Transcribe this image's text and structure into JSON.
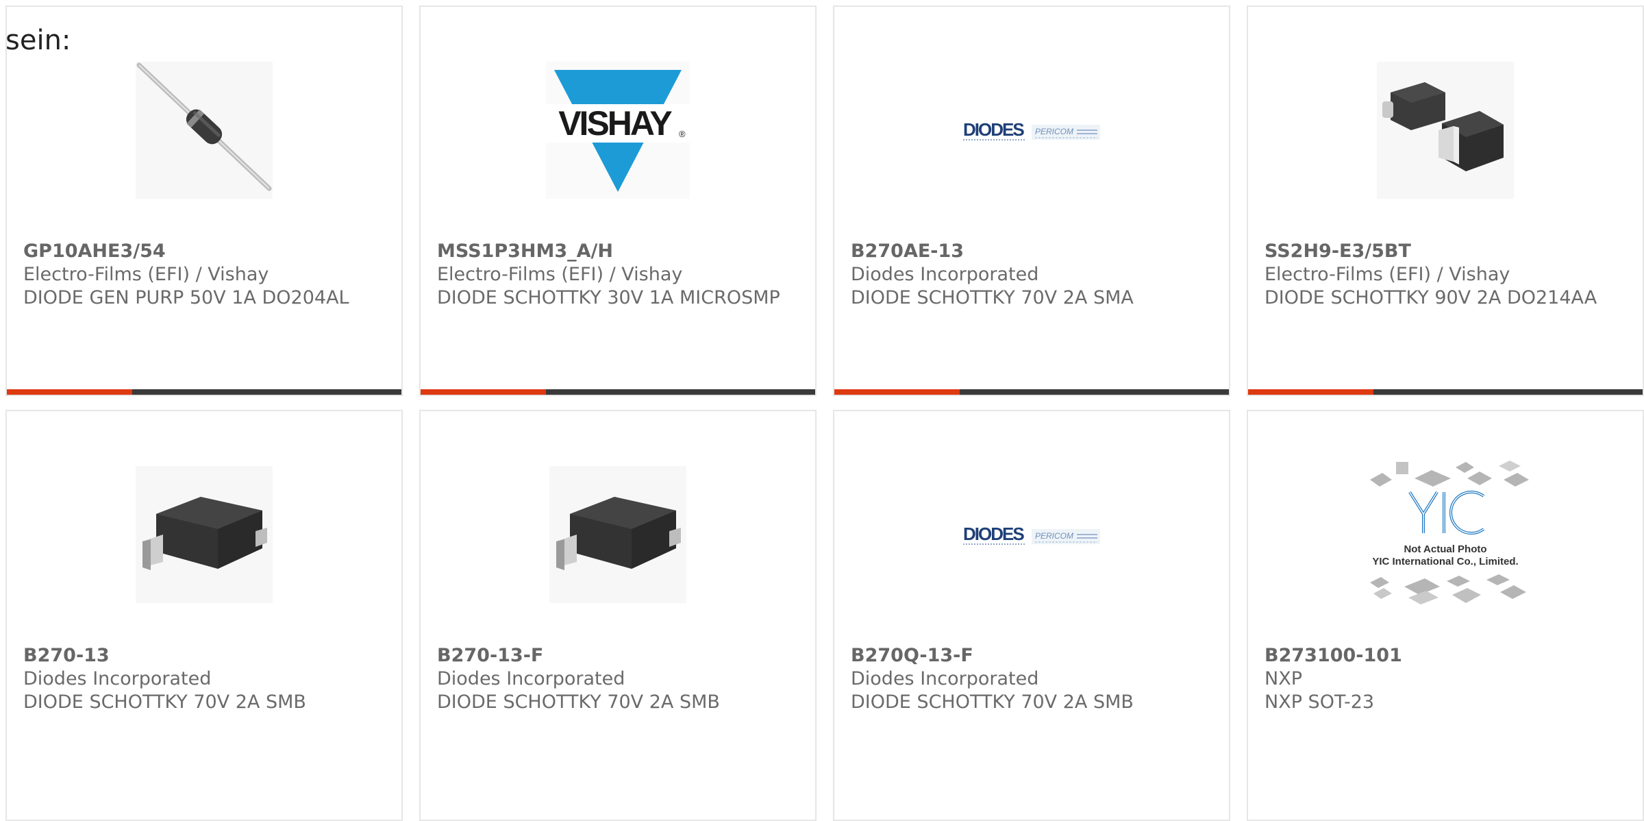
{
  "intro_text": "sein:",
  "products": [
    {
      "part_number": "GP10AHE3/54",
      "manufacturer": "Electro-Films (EFI) / Vishay",
      "description": "DIODE GEN PURP 50V 1A DO204AL",
      "image": "axial-diode-icon"
    },
    {
      "part_number": "MSS1P3HM3_A/H",
      "manufacturer": "Electro-Films (EFI) / Vishay",
      "description": "DIODE SCHOTTKY 30V 1A MICROSMP",
      "image": "vishay-logo"
    },
    {
      "part_number": "B270AE-13",
      "manufacturer": "Diodes Incorporated",
      "description": "DIODE SCHOTTKY 70V 2A SMA",
      "image": "diodes-pericom-logo"
    },
    {
      "part_number": "SS2H9-E3/5BT",
      "manufacturer": "Electro-Films (EFI) / Vishay",
      "description": "DIODE SCHOTTKY 90V 2A DO214AA",
      "image": "smd-diode-pair-icon"
    },
    {
      "part_number": "B270-13",
      "manufacturer": "Diodes Incorporated",
      "description": "DIODE SCHOTTKY 70V 2A SMB",
      "image": "smb-package-icon"
    },
    {
      "part_number": "B270-13-F",
      "manufacturer": "Diodes Incorporated",
      "description": "DIODE SCHOTTKY 70V 2A SMB",
      "image": "smb-package-icon"
    },
    {
      "part_number": "B270Q-13-F",
      "manufacturer": "Diodes Incorporated",
      "description": "DIODE SCHOTTKY 70V 2A SMB",
      "image": "diodes-pericom-logo"
    },
    {
      "part_number": "B273100-101",
      "manufacturer": "NXP",
      "description": "NXP SOT-23",
      "image": "yic-placeholder"
    }
  ],
  "logos": {
    "vishay": "VISHAY",
    "vishay_mark": "®",
    "diodes": "DIODES",
    "pericom": "PERICOM",
    "yic": "YIC",
    "yic_line1": "Not Actual Photo",
    "yic_line2": "YIC International Co., Limited."
  },
  "colors": {
    "accent": "#dd3a11",
    "bar": "#3a3a3a",
    "vishay_blue": "#1d9bd7",
    "diodes_navy": "#1f3f78",
    "text": "#666666"
  }
}
